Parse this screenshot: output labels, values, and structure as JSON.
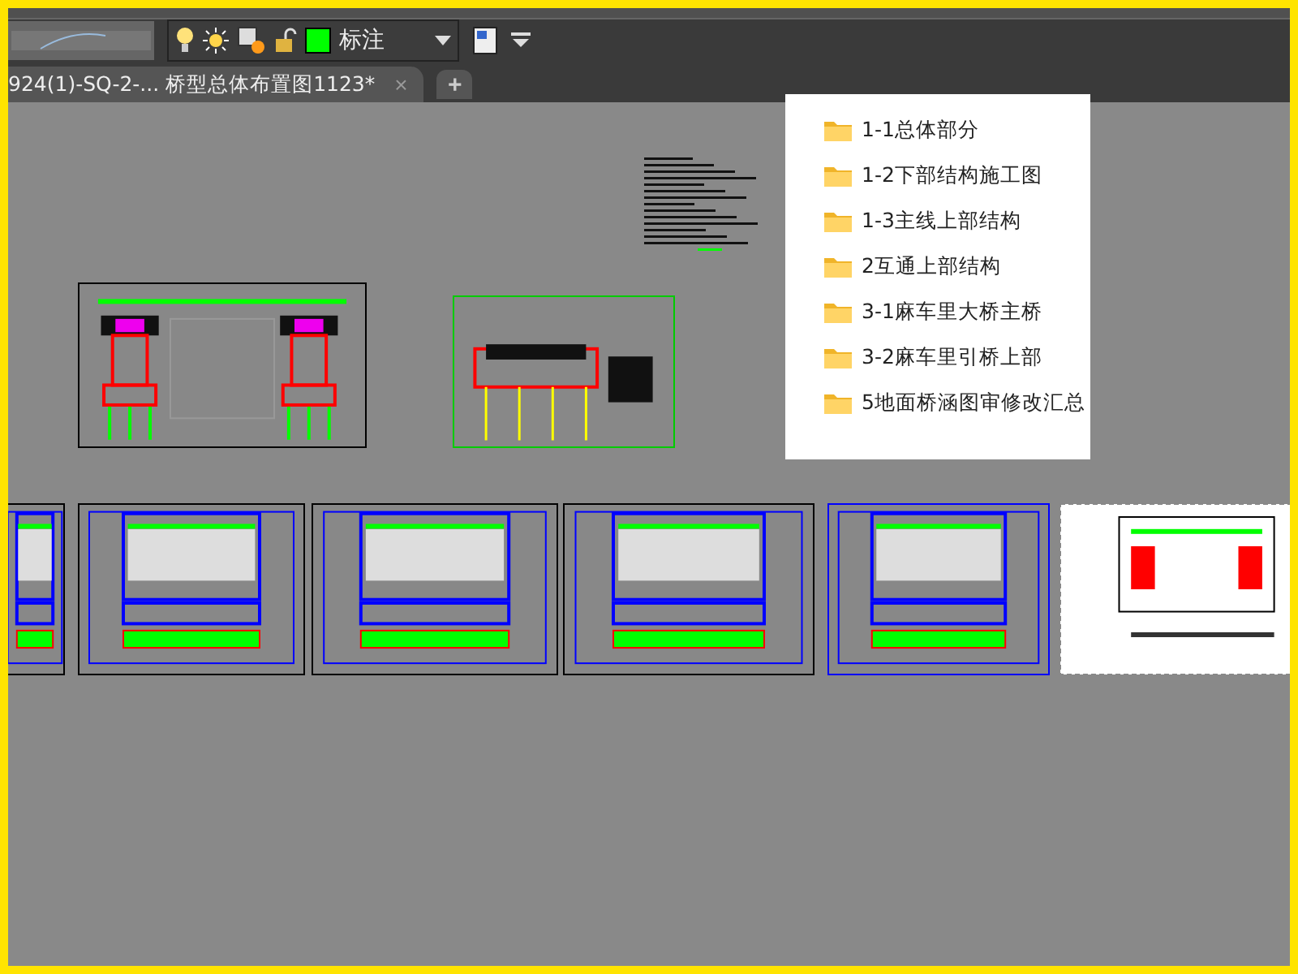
{
  "toolbar": {
    "layer": {
      "name": "标注",
      "color": "#00ff00"
    }
  },
  "tabs": [
    {
      "label": "924(1)-SQ-2-... 桥型总体布置图1123*",
      "close": "×",
      "selected": true
    }
  ],
  "new_tab": "+",
  "folder_menu": {
    "items": [
      {
        "label": "1-1总体部分"
      },
      {
        "label": "1-2下部结构施工图"
      },
      {
        "label": "1-3主线上部结构"
      },
      {
        "label": "2互通上部结构"
      },
      {
        "label": "3-1麻车里大桥主桥"
      },
      {
        "label": "3-2麻车里引桥上部"
      },
      {
        "label": "5地面桥涵图审修改汇总"
      }
    ]
  }
}
